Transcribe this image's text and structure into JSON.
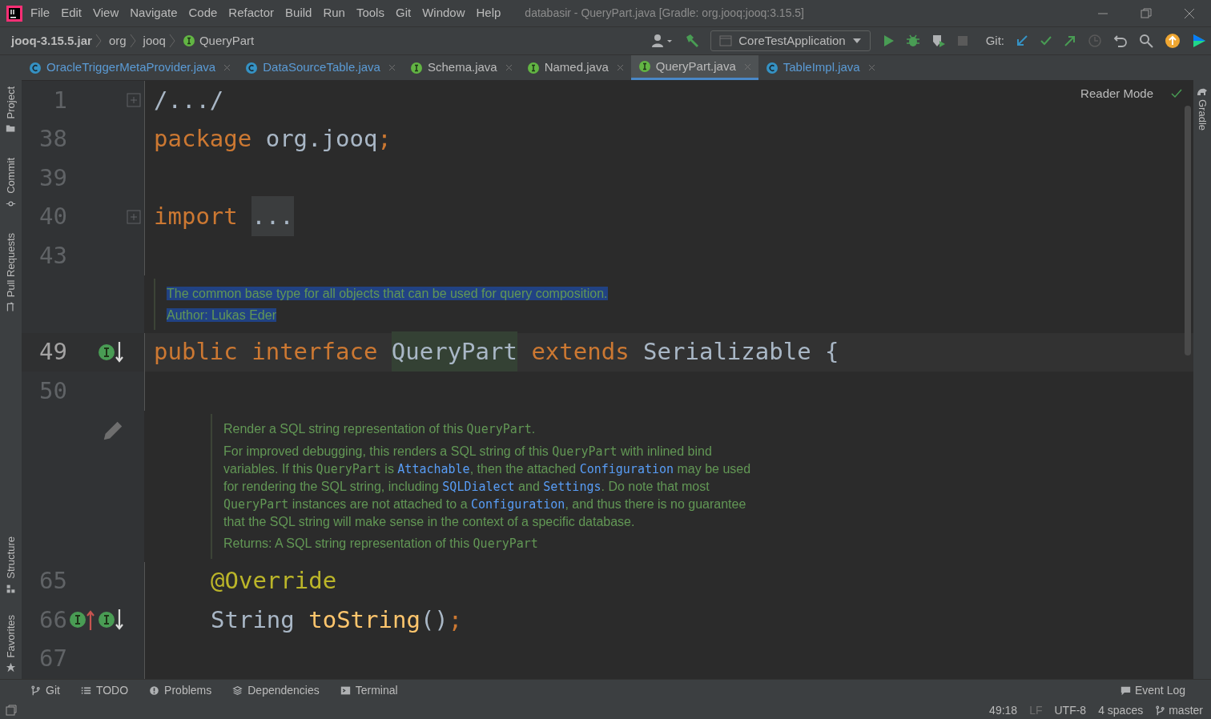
{
  "menu": [
    "File",
    "Edit",
    "View",
    "Navigate",
    "Code",
    "Refactor",
    "Build",
    "Run",
    "Tools",
    "Git",
    "Window",
    "Help"
  ],
  "window": {
    "title": "databasir - QueryPart.java [Gradle: org.jooq:jooq:3.15.5]"
  },
  "breadcrumbs": [
    {
      "label": "jooq-3.15.5.jar",
      "kind": "jar"
    },
    {
      "label": "org",
      "kind": "package"
    },
    {
      "label": "jooq",
      "kind": "package"
    },
    {
      "label": "QueryPart",
      "kind": "interface"
    }
  ],
  "run_config": "CoreTestApplication",
  "git_label": "Git:",
  "tabs": [
    {
      "label": "OracleTriggerMetaProvider.java",
      "kind": "class",
      "selected": false
    },
    {
      "label": "DataSourceTable.java",
      "kind": "class",
      "selected": false
    },
    {
      "label": "Schema.java",
      "kind": "interface",
      "selected": false
    },
    {
      "label": "Named.java",
      "kind": "interface",
      "selected": false
    },
    {
      "label": "QueryPart.java",
      "kind": "interface",
      "selected": true
    },
    {
      "label": "TableImpl.java",
      "kind": "class",
      "selected": false
    }
  ],
  "left_tools": [
    {
      "label": "Project",
      "kind": "folder"
    },
    {
      "label": "Commit",
      "kind": "commit"
    },
    {
      "label": "Pull Requests",
      "kind": "pull"
    }
  ],
  "left_tools_bottom": [
    {
      "label": "Structure",
      "kind": "structure"
    },
    {
      "label": "Favorites",
      "kind": "star"
    }
  ],
  "right_tools": [
    {
      "label": "Gradle"
    }
  ],
  "reader_mode": "Reader Mode",
  "lines": [
    {
      "kind": "code",
      "number": "1",
      "folded": true,
      "current": false,
      "tokens": [
        {
          "text": "/.../",
          "kind": "plain"
        }
      ]
    },
    {
      "kind": "code",
      "number": "38",
      "folded": false,
      "current": false,
      "tokens": [
        {
          "text": "package",
          "kind": "keyword"
        },
        {
          "text": " org.jooq",
          "kind": "plain"
        },
        {
          "text": ";",
          "kind": "keyword"
        }
      ]
    },
    {
      "kind": "code",
      "number": "39",
      "folded": false,
      "current": false
    },
    {
      "kind": "code",
      "number": "40",
      "folded": true,
      "current": false,
      "tokens": [
        {
          "text": "import ",
          "kind": "keyword"
        },
        {
          "text": "...",
          "kind": "fold"
        }
      ]
    },
    {
      "kind": "code",
      "number": "43",
      "folded": false,
      "current": false
    },
    {
      "kind": "doc",
      "selected": true,
      "editable": false,
      "paragraphs": [
        [
          {
            "text": "The common base type for all objects that can be used for query composition.",
            "kind": "text"
          }
        ],
        [
          {
            "text": "Author: Lukas Eder",
            "kind": "text"
          }
        ]
      ]
    },
    {
      "kind": "code",
      "number": "49",
      "folded": false,
      "current": true,
      "markers": [
        {
          "kind": "implemented"
        }
      ],
      "tokens": [
        {
          "text": "public interface ",
          "kind": "keyword"
        },
        {
          "text": "QueryPart",
          "kind": "highlight"
        },
        {
          "text": " extends ",
          "kind": "keyword"
        },
        {
          "text": "Serializable {",
          "kind": "plain"
        }
      ],
      "children": [
        {
          "kind": "code",
          "number": "50",
          "folded": false,
          "current": false
        },
        {
          "kind": "doc",
          "selected": false,
          "editable": true,
          "paragraphs": [
            [
              {
                "text": "Render a SQL string representation of this ",
                "kind": "text"
              },
              {
                "text": "QueryPart",
                "kind": "code"
              },
              {
                "text": ".",
                "kind": "text"
              }
            ],
            [
              {
                "text": "For improved debugging, this renders a SQL string of this ",
                "kind": "text"
              },
              {
                "text": "QueryPart",
                "kind": "code"
              },
              {
                "text": " with inlined bind variables. If this ",
                "kind": "text"
              },
              {
                "text": "QueryPart",
                "kind": "code"
              },
              {
                "text": " is ",
                "kind": "text"
              },
              {
                "text": "Attachable",
                "kind": "link"
              },
              {
                "text": ", then the attached ",
                "kind": "text"
              },
              {
                "text": "Configuration",
                "kind": "link"
              },
              {
                "text": " may be used for rendering the SQL string, including ",
                "kind": "text"
              },
              {
                "text": "SQLDialect",
                "kind": "link"
              },
              {
                "text": " and ",
                "kind": "text"
              },
              {
                "text": "Settings",
                "kind": "link"
              },
              {
                "text": ". Do note that most ",
                "kind": "text"
              },
              {
                "text": "QueryPart",
                "kind": "code"
              },
              {
                "text": " instances are not attached to a ",
                "kind": "text"
              },
              {
                "text": "Configuration",
                "kind": "link"
              },
              {
                "text": ", and thus there is no guarantee that the SQL string will make sense in the context of a specific database.",
                "kind": "text"
              }
            ],
            [
              {
                "text": "Returns: A SQL string representation of this ",
                "kind": "text"
              },
              {
                "text": "QueryPart",
                "kind": "code"
              }
            ]
          ]
        },
        {
          "kind": "code",
          "number": "65",
          "folded": false,
          "current": false,
          "tokens": [
            {
              "text": "@Override",
              "kind": "annotation"
            }
          ]
        },
        {
          "kind": "code",
          "number": "66",
          "folded": false,
          "current": false,
          "markers": [
            {
              "kind": "implements"
            },
            {
              "kind": "implemented"
            }
          ],
          "tokens": [
            {
              "text": "String ",
              "kind": "plain"
            },
            {
              "text": "toString",
              "kind": "method"
            },
            {
              "text": "()",
              "kind": "plain"
            },
            {
              "text": ";",
              "kind": "keyword"
            }
          ]
        },
        {
          "kind": "code",
          "number": "67",
          "folded": false,
          "current": false
        }
      ]
    }
  ],
  "bottom_tools": [
    {
      "label": "Git",
      "kind": "branch"
    },
    {
      "label": "TODO",
      "kind": "list"
    },
    {
      "label": "Problems",
      "kind": "info"
    },
    {
      "label": "Dependencies",
      "kind": "layers"
    },
    {
      "label": "Terminal",
      "kind": "terminal"
    }
  ],
  "event_log": "Event Log",
  "status": [
    {
      "label": "49:18",
      "kind": "text"
    },
    {
      "label": "LF",
      "kind": "dim"
    },
    {
      "label": "UTF-8",
      "kind": "text"
    },
    {
      "label": "4 spaces",
      "kind": "text"
    },
    {
      "label": "master",
      "kind": "branch"
    }
  ]
}
